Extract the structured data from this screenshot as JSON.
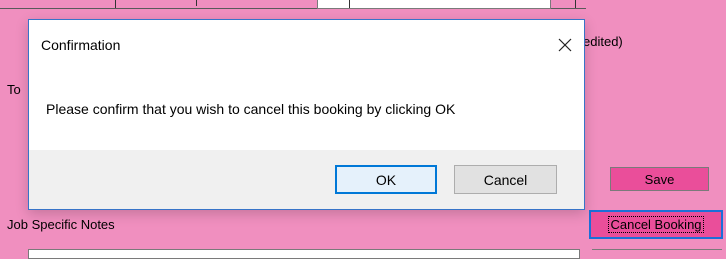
{
  "background": {
    "edited_fragment": "edited)",
    "tod_fragment": "To",
    "job_notes_label": "Job Specific Notes",
    "save_label": "Save",
    "cancel_booking_label": "Cancel Booking",
    "colors": {
      "form_bg": "#f08fbf",
      "button_bg": "#ea4e9a",
      "focus_border": "#1b6fd8"
    }
  },
  "dialog": {
    "title": "Confirmation",
    "close_icon": "close-icon",
    "message": "Please confirm that you wish to cancel this booking by clicking OK",
    "ok_label": "OK",
    "cancel_label": "Cancel"
  }
}
